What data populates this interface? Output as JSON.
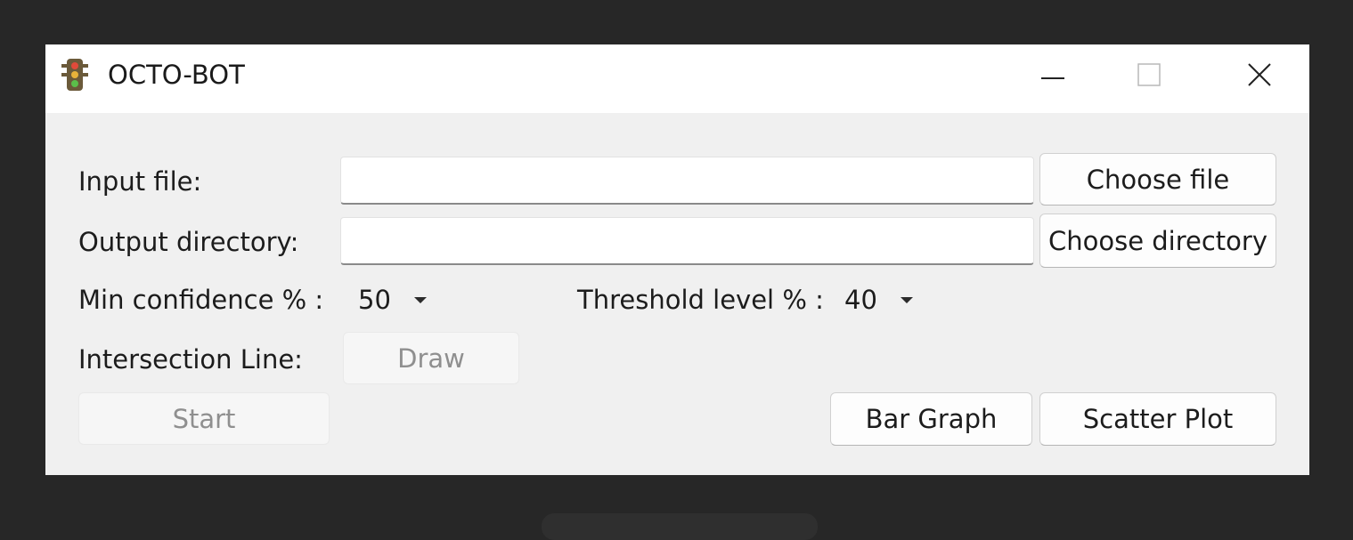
{
  "window": {
    "title": "OCTO-BOT",
    "icon": "traffic-light-icon"
  },
  "controls": {
    "minimize": "minimize-icon",
    "maximize": "maximize-icon",
    "close": "close-icon"
  },
  "form": {
    "input_file_label": "Input file:",
    "input_file_value": "",
    "choose_file_label": "Choose file",
    "output_dir_label": "Output directory:",
    "output_dir_value": "",
    "choose_dir_label": "Choose directory",
    "min_conf_label": "Min confidence % :",
    "min_conf_value": "50",
    "threshold_label": "Threshold level % :",
    "threshold_value": "40",
    "intersection_label": "Intersection Line:",
    "draw_label": "Draw",
    "start_label": "Start",
    "bar_graph_label": "Bar Graph",
    "scatter_plot_label": "Scatter Plot"
  },
  "colors": {
    "window_bg": "#f0f0f0",
    "titlebar_bg": "#ffffff",
    "desktop_bg": "#272727"
  }
}
